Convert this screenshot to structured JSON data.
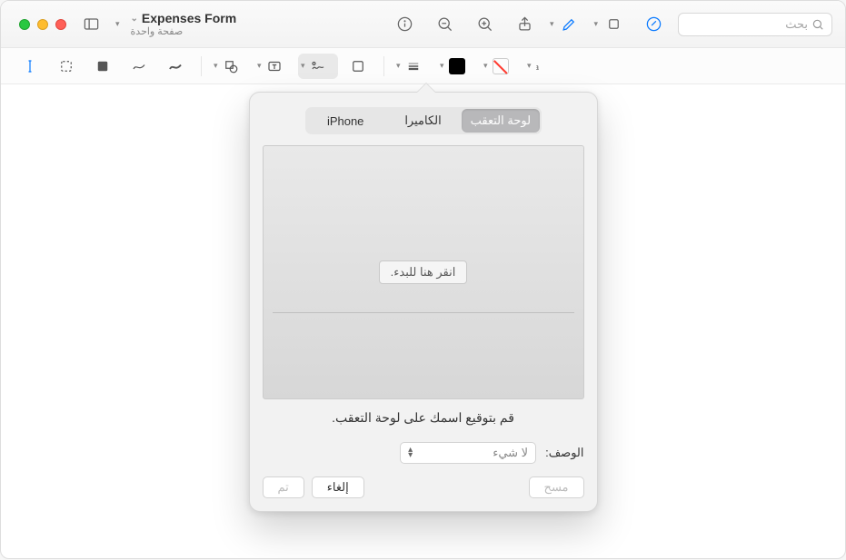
{
  "window": {
    "title": "Expenses Form",
    "subtitle": "صفحة واحدة"
  },
  "toolbar": {
    "search_placeholder": "بحث"
  },
  "signature_popover": {
    "tabs": {
      "trackpad": "لوحة التعقب",
      "camera": "الكاميرا",
      "iphone": "iPhone"
    },
    "start_label": "انقر هنا للبدء.",
    "hint": "قم بتوقيع اسمك على لوحة التعقب.",
    "description_label": "الوصف:",
    "description_value": "لا شيء",
    "clear_button": "مسح",
    "cancel_button": "إلغاء",
    "done_button": "تم"
  }
}
